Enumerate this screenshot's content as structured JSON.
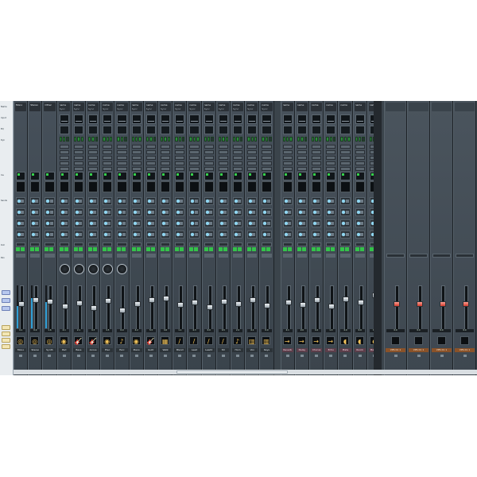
{
  "app": {
    "name": ""
  },
  "left_panel": {
    "row_tags": [
      "Name",
      "Input",
      "EQ",
      "Dyn",
      "Ins",
      "Sends",
      "Out",
      "Pan"
    ],
    "bottom_tabs": [
      "",
      "",
      "",
      "",
      "",
      "",
      ""
    ]
  },
  "channels": [
    {
      "name": "Mono",
      "top": "Mono",
      "sub": "",
      "value": "4.1",
      "icon": "◎",
      "knob": false,
      "meter": 52,
      "fader": 40,
      "type": "mono"
    },
    {
      "name": "Stereo",
      "top": "Stereo",
      "sub": "",
      "value": "0.0",
      "icon": "◎",
      "knob": false,
      "meter": 70,
      "fader": 30,
      "type": "mono"
    },
    {
      "name": "Synth",
      "top": "Other",
      "sub": "",
      "value": "1.6",
      "icon": "◎",
      "knob": false,
      "meter": 62,
      "fader": 34,
      "type": "mono"
    },
    {
      "name": "Pad",
      "top": "name",
      "sub": "Sync",
      "value": "4.1",
      "icon": "◉",
      "knob": true,
      "meter": 0,
      "fader": 45,
      "type": "eq"
    },
    {
      "name": "Bass",
      "top": "name",
      "sub": "Sync",
      "value": "2.1",
      "icon": "🎸",
      "knob": true,
      "meter": 0,
      "fader": 37,
      "type": "eq"
    },
    {
      "name": "Acous",
      "top": "name",
      "sub": "Sync",
      "value": "4.3",
      "icon": "🎸",
      "knob": true,
      "meter": 0,
      "fader": 50,
      "type": "eq"
    },
    {
      "name": "Elec",
      "top": "name",
      "sub": "Sync",
      "value": "4.5",
      "icon": "◉",
      "knob": true,
      "meter": 0,
      "fader": 32,
      "type": "eq"
    },
    {
      "name": "Perc",
      "top": "name",
      "sub": "Sync",
      "value": "0.0",
      "icon": "♪",
      "knob": true,
      "meter": 0,
      "fader": 55,
      "type": "eq"
    },
    {
      "name": "Piano",
      "top": "name",
      "sub": "Sync",
      "value": "4.2",
      "icon": "◉",
      "knob": false,
      "meter": 0,
      "fader": 40,
      "type": "eq"
    },
    {
      "name": "Guitr",
      "top": "name",
      "sub": "Sync",
      "value": "3.3",
      "icon": "🎸",
      "knob": false,
      "meter": 0,
      "fader": 30,
      "type": "eq"
    },
    {
      "name": "Walk",
      "top": "name",
      "sub": "Sync",
      "value": "4.0",
      "icon": "▦",
      "knob": false,
      "meter": 0,
      "fader": 25,
      "type": "eq"
    },
    {
      "name": "Blend",
      "top": "name",
      "sub": "Sync",
      "value": "1.1",
      "icon": "/",
      "knob": false,
      "meter": 0,
      "fader": 42,
      "type": "eq"
    },
    {
      "name": "Lead",
      "top": "name",
      "sub": "Sync",
      "value": "4.3",
      "icon": "/",
      "knob": false,
      "meter": 0,
      "fader": 36,
      "type": "eq"
    },
    {
      "name": "Lead2",
      "top": "name",
      "sub": "Sync",
      "value": "0.0",
      "icon": "/",
      "knob": false,
      "meter": 0,
      "fader": 47,
      "type": "eq"
    },
    {
      "name": "Str",
      "top": "name",
      "sub": "Sync",
      "value": "4.5",
      "icon": "/",
      "knob": false,
      "meter": 0,
      "fader": 33,
      "type": "eq"
    },
    {
      "name": "Horn",
      "top": "name",
      "sub": "Sync",
      "value": "2.2",
      "icon": "♪",
      "knob": false,
      "meter": 0,
      "fader": 40,
      "type": "eq"
    },
    {
      "name": "Vox",
      "top": "name",
      "sub": "Sync",
      "value": "4.1",
      "icon": "▥",
      "knob": false,
      "meter": 0,
      "fader": 29,
      "type": "eq"
    },
    {
      "name": "Keys",
      "top": "name",
      "sub": "Sync",
      "value": "0.0",
      "icon": "▥",
      "knob": false,
      "meter": 0,
      "fader": 44,
      "type": "eq"
    },
    {
      "name": "Reverb",
      "top": "name",
      "sub": "",
      "value": "4.1",
      "icon": "→",
      "knob": false,
      "meter": 0,
      "fader": 35,
      "type": "fx"
    },
    {
      "name": "Delay",
      "top": "name",
      "sub": "",
      "value": "2.0",
      "icon": "→",
      "knob": false,
      "meter": 0,
      "fader": 41,
      "type": "fx"
    },
    {
      "name": "Chorus",
      "top": "name",
      "sub": "",
      "value": "4.2",
      "icon": "→",
      "knob": false,
      "meter": 0,
      "fader": 30,
      "type": "fx"
    },
    {
      "name": "Echo",
      "top": "name",
      "sub": "",
      "value": "1.3",
      "icon": "→",
      "knob": false,
      "meter": 0,
      "fader": 45,
      "type": "fx"
    },
    {
      "name": "Plate",
      "top": "name",
      "sub": "",
      "value": "4.0",
      "icon": "◖",
      "knob": false,
      "meter": 0,
      "fader": 28,
      "type": "fx"
    },
    {
      "name": "Room",
      "top": "name",
      "sub": "",
      "value": "0.0",
      "icon": "◖",
      "knob": false,
      "meter": 0,
      "fader": 36,
      "type": "fx"
    },
    {
      "name": "Master",
      "top": "name",
      "sub": "",
      "value": "4.0",
      "icon": "◖",
      "knob": false,
      "meter": 0,
      "fader": 18,
      "type": "fx"
    }
  ],
  "outputs": [
    {
      "name": "VPS 01 1",
      "value": "0.0",
      "fader": 40
    },
    {
      "name": "VPS 01 1",
      "value": "0.0",
      "fader": 40
    },
    {
      "name": "VPS 01 1",
      "value": "0.0",
      "fader": 40
    },
    {
      "name": "VPS 01 1",
      "value": "0.0",
      "fader": 40
    }
  ]
}
